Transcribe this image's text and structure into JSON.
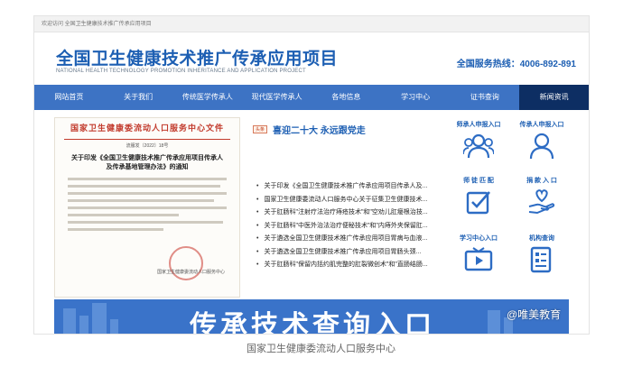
{
  "topbar": {
    "text": "欢迎访问 全国卫生健康技术推广传承应用项目"
  },
  "header": {
    "title_cn": "全国卫生健康技术推广传承应用项目",
    "title_en": "NATIONAL HEALTH TECHNOLOGY PROMOTION INHERITANCE AND APPLICATION PROJECT",
    "hotline": "全国服务热线：4006-892-891"
  },
  "nav": {
    "items": [
      "网站首页",
      "关于我们",
      "传统医学传承人",
      "现代医学传承人",
      "各地信息",
      "学习中心",
      "证书查询",
      "新闻资讯"
    ],
    "active_index": 7
  },
  "doc": {
    "header": "国家卫生健康委流动人口服务中心文件",
    "number": "流服发〔2022〕18号",
    "title": "关于印发《全国卫生健康技术推广传承应用项目传承人及传承基地管理办法》的通知",
    "signature": "国家卫生健康委流动人口服务中心"
  },
  "news": {
    "tag": "头条",
    "headline": "喜迎二十大 永远跟党走",
    "items": [
      "关于印发《全国卫生健康技术推广传承应用项目传承人及...",
      "国家卫生健康委流动人口服务中心关于征集卫生健康技术...",
      "关于肛肠科\"注射疗法治疗痔疮技术\"和\"空劝儿肛瘘根治技...",
      "关于肛肠科\"中医外治法治疗便秘技术\"和\"内痔外夹保留肛...",
      "关于遴选全国卫生健康技术推广传承应用项目胃病与血液...",
      "关于遴选全国卫生健康技术推广传承应用项目胃肠头颈...",
      "关于肛肠科\"保留内括约肌完整的肛裂微创术\"和\"直肠结肠..."
    ]
  },
  "quick": {
    "items": [
      {
        "label": "师承人申报入口",
        "icon": "users-group-icon"
      },
      {
        "label": "传承人申报入口",
        "icon": "user-icon"
      },
      {
        "label": "师 徒 匹 配",
        "icon": "checkbox-icon"
      },
      {
        "label": "捐 款 入 口",
        "icon": "donate-hand-icon"
      },
      {
        "label": "学习中心入口",
        "icon": "video-screen-icon"
      },
      {
        "label": "机构查询",
        "icon": "document-list-icon"
      }
    ],
    "color": "#1d5fb3"
  },
  "banner": {
    "text": "传承技术查询入口"
  },
  "watermark": "@唯美教育",
  "caption": "国家卫生健康委流动人口服务中心"
}
